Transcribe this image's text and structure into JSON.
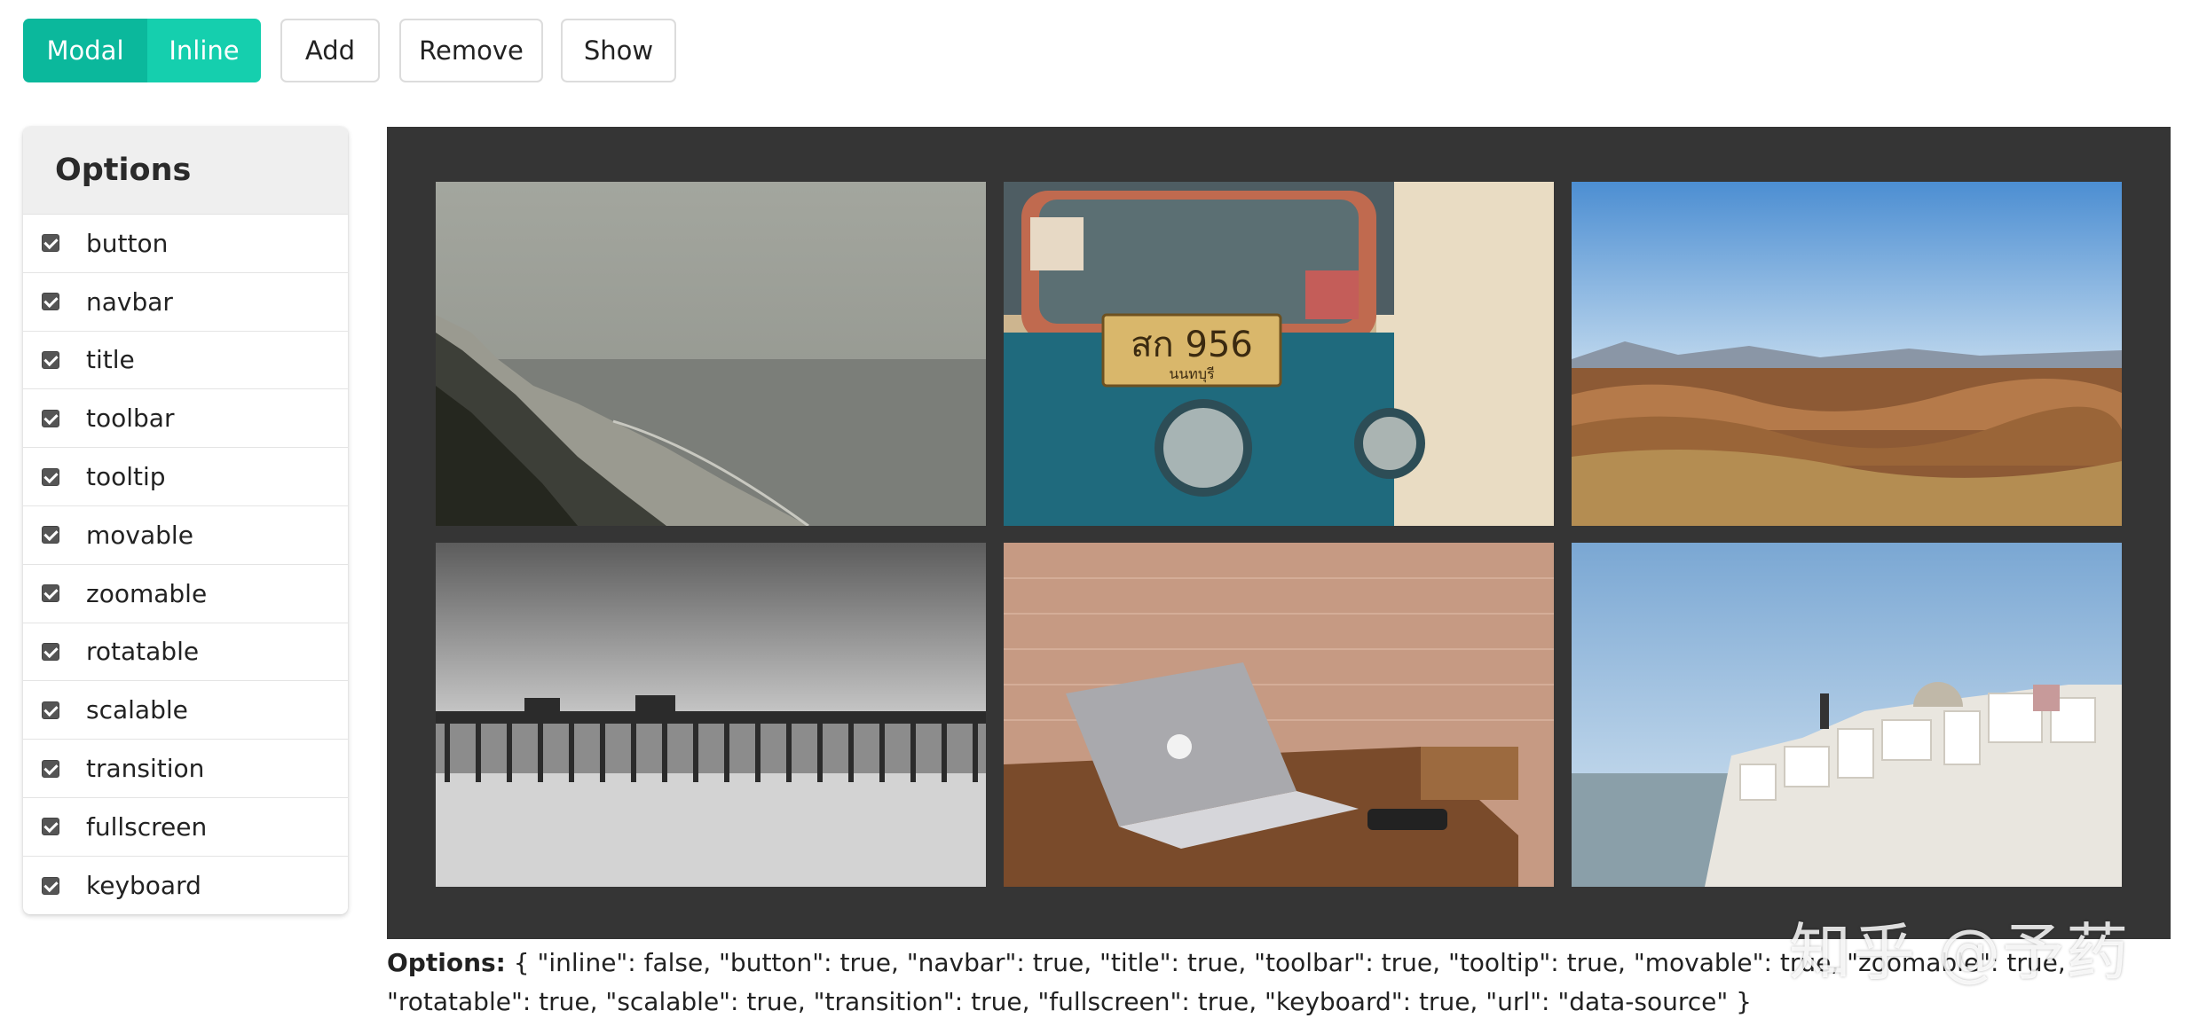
{
  "toolbar": {
    "modal_label": "Modal",
    "inline_label": "Inline",
    "add_label": "Add",
    "remove_label": "Remove",
    "show_label": "Show"
  },
  "options": {
    "title": "Options",
    "items": [
      {
        "label": "button",
        "checked": true
      },
      {
        "label": "navbar",
        "checked": true
      },
      {
        "label": "title",
        "checked": true
      },
      {
        "label": "toolbar",
        "checked": true
      },
      {
        "label": "tooltip",
        "checked": true
      },
      {
        "label": "movable",
        "checked": true
      },
      {
        "label": "zoomable",
        "checked": true
      },
      {
        "label": "rotatable",
        "checked": true
      },
      {
        "label": "scalable",
        "checked": true
      },
      {
        "label": "transition",
        "checked": true
      },
      {
        "label": "fullscreen",
        "checked": true
      },
      {
        "label": "keyboard",
        "checked": true
      }
    ]
  },
  "gallery": {
    "images": [
      {
        "name": "foggy-beach-coast"
      },
      {
        "name": "tuk-tuk-license-plate",
        "plate_text": "สก 956",
        "plate_sub": "นนทบุรี"
      },
      {
        "name": "desert-hills-landscape"
      },
      {
        "name": "pier-over-ocean"
      },
      {
        "name": "laptop-on-wooden-table"
      },
      {
        "name": "santorini-village"
      }
    ]
  },
  "output": {
    "label": "Options:",
    "text": " { \"inline\": false, \"button\": true, \"navbar\": true, \"title\": true, \"toolbar\": true, \"tooltip\": true, \"movable\": true, \"zoomable\": true, \"rotatable\": true, \"scalable\": true, \"transition\": true, \"fullscreen\": true, \"keyboard\": true, \"url\": \"data-source\" }"
  },
  "watermark": "知乎 @予药",
  "colors": {
    "modal_active": "#0bb89c",
    "inline": "#15cfae",
    "gallery_bg": "#353535"
  }
}
